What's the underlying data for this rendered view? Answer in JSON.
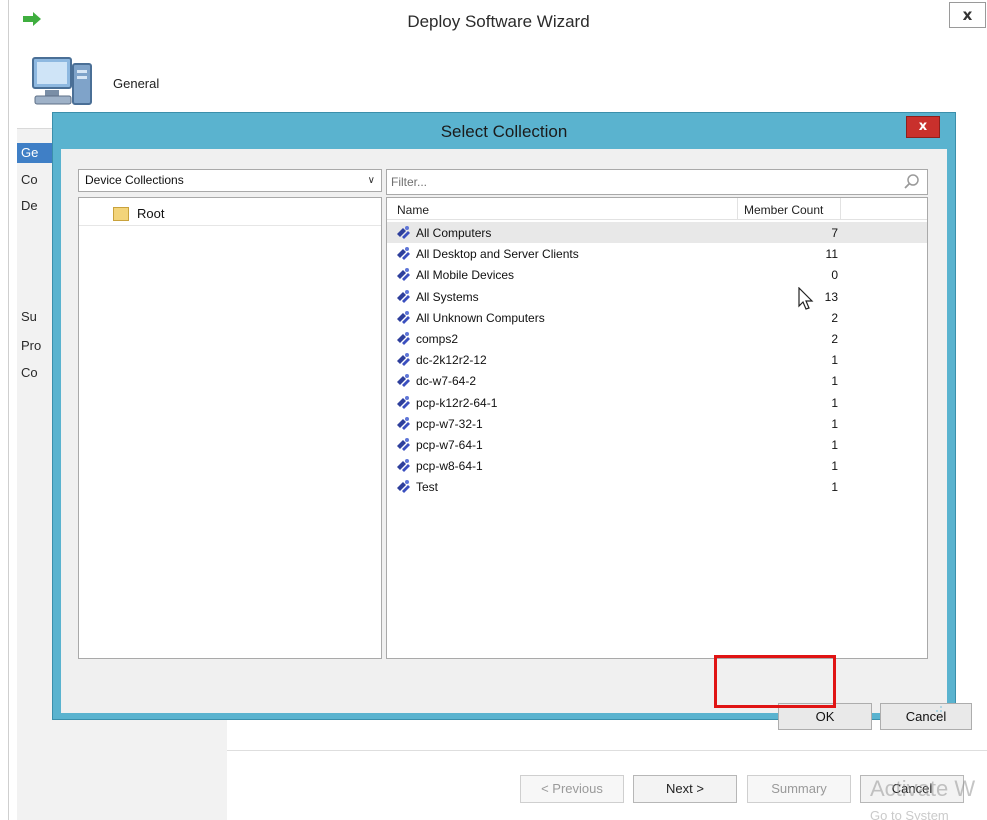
{
  "wizard": {
    "title": "Deploy Software Wizard",
    "close_glyph": "x",
    "header_title": "General",
    "nav_items": [
      "Ge",
      "Co",
      "De",
      "Su",
      "Pro",
      "Co"
    ],
    "buttons": {
      "previous": "< Previous",
      "next": "Next >",
      "summary": "Summary",
      "cancel": "Cancel"
    },
    "watermark_main": "Activate W",
    "watermark_sub": "Go to System"
  },
  "dialog": {
    "title": "Select Collection",
    "close_glyph": "x",
    "collection_type": "Device Collections",
    "tree_root": "Root",
    "filter_placeholder": "Filter...",
    "columns": {
      "name": "Name",
      "member_count": "Member Count"
    },
    "rows": [
      {
        "name": "All Computers",
        "count": "7"
      },
      {
        "name": "All Desktop and Server Clients",
        "count": "11"
      },
      {
        "name": "All Mobile Devices",
        "count": "0"
      },
      {
        "name": "All Systems",
        "count": "13"
      },
      {
        "name": "All Unknown Computers",
        "count": "2"
      },
      {
        "name": "comps2",
        "count": "2"
      },
      {
        "name": "dc-2k12r2-12",
        "count": "1"
      },
      {
        "name": "dc-w7-64-2",
        "count": "1"
      },
      {
        "name": "pcp-k12r2-64-1",
        "count": "1"
      },
      {
        "name": "pcp-w7-32-1",
        "count": "1"
      },
      {
        "name": "pcp-w7-64-1",
        "count": "1"
      },
      {
        "name": "pcp-w8-64-1",
        "count": "1"
      },
      {
        "name": "Test",
        "count": "1"
      }
    ],
    "ok_label": "OK",
    "cancel_label": "Cancel"
  },
  "colors": {
    "dialog_frame": "#5ab3cf",
    "dialog_close": "#c9302c",
    "nav_active": "#3f7fc6",
    "highlight_box": "#e01414"
  }
}
